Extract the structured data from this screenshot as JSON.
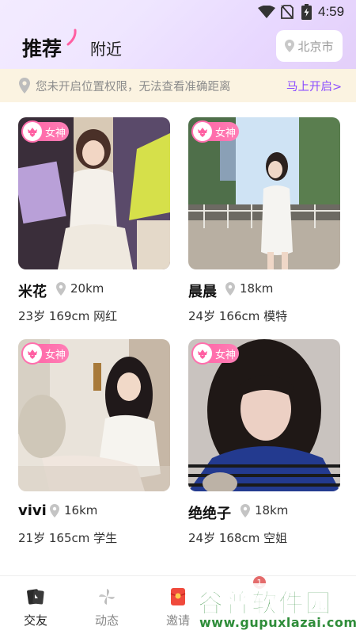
{
  "status_bar": {
    "time": "4:59"
  },
  "header": {
    "tabs": [
      {
        "label": "推荐",
        "active": true
      },
      {
        "label": "附近",
        "active": false
      }
    ],
    "city": "北京市"
  },
  "banner": {
    "text": "您未开启位置权限，无法查看准确距离",
    "action": "马上开启>"
  },
  "colors": {
    "accent": "#8a4cff",
    "badge_pink": "#ff5fa2",
    "banner_bg": "#fbf3e1"
  },
  "cards": [
    {
      "badge": "女神",
      "name": "米花",
      "distance": "20km",
      "info": "23岁  169cm  网红"
    },
    {
      "badge": "女神",
      "name": "晨晨",
      "distance": "18km",
      "info": "24岁  166cm  模特"
    },
    {
      "badge": "女神",
      "name": "vivi",
      "distance": "16km",
      "info": "21岁  165cm  学生"
    },
    {
      "badge": "女神",
      "name": "绝绝子",
      "distance": "18km",
      "info": "24岁  168cm  空姐"
    }
  ],
  "bottom_nav": [
    {
      "label": "交友",
      "icon": "chat-cards-icon",
      "active": true
    },
    {
      "label": "动态",
      "icon": "pinwheel-icon",
      "active": false
    },
    {
      "label": "邀请",
      "icon": "red-envelope-icon",
      "active": false,
      "badge": "1"
    }
  ],
  "watermark": {
    "title": "谷普软件园",
    "url": "www.gupuxlazai.com"
  }
}
